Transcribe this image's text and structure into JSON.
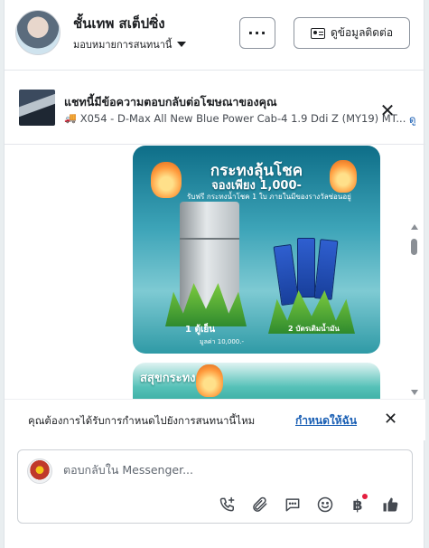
{
  "header": {
    "name": "ชั้นเทพ สเต็ปซิ่ง",
    "assign_label": "มอบหมายการสนทนานี้",
    "more_label": "···",
    "contact_info_label": "ดูข้อมูลติดต่อ"
  },
  "ad_context": {
    "title": "แชทนี้มีข้อความตอบกลับต่อโฆษณาของคุณ",
    "subtitle": "X054 - D-Max All New Blue Power Cab-4 1.9 Ddi Z (MY19) MT...",
    "link": "ดู",
    "close": "✕"
  },
  "promo1": {
    "title": "กระทงลุ้นโชค",
    "price": "จองเพียง 1,000-",
    "note": "รับฟรี กระทงน้ำโชค 1 ใบ ภายในมีของรางวัลซ่อนอยู่",
    "prize1_label": "ตู้เย็น",
    "prize1_value": "มูลค่า 10,000.-",
    "prize2_label": "บัตรเติมน้ำมัน",
    "badge1": "1",
    "badge2": "2"
  },
  "promo2": {
    "title": "สสุขกระทง"
  },
  "suggestion": {
    "text": "คุณต้องการได้รับการกำหนดไปยังการสนทนานี้ไหม",
    "action": "กำหนดให้ฉัน",
    "close": "✕"
  },
  "composer": {
    "placeholder": "ตอบกลับใน Messenger...",
    "baht_symbol": "฿",
    "tools": [
      "call-add-icon",
      "attachment-icon",
      "saved-reply-icon",
      "emoji-icon",
      "payment-icon",
      "thumbs-up-icon"
    ]
  },
  "colors": {
    "link": "#1a5fb4",
    "promo_teal": "#3da4b8",
    "notification_red": "#e41e3f"
  }
}
